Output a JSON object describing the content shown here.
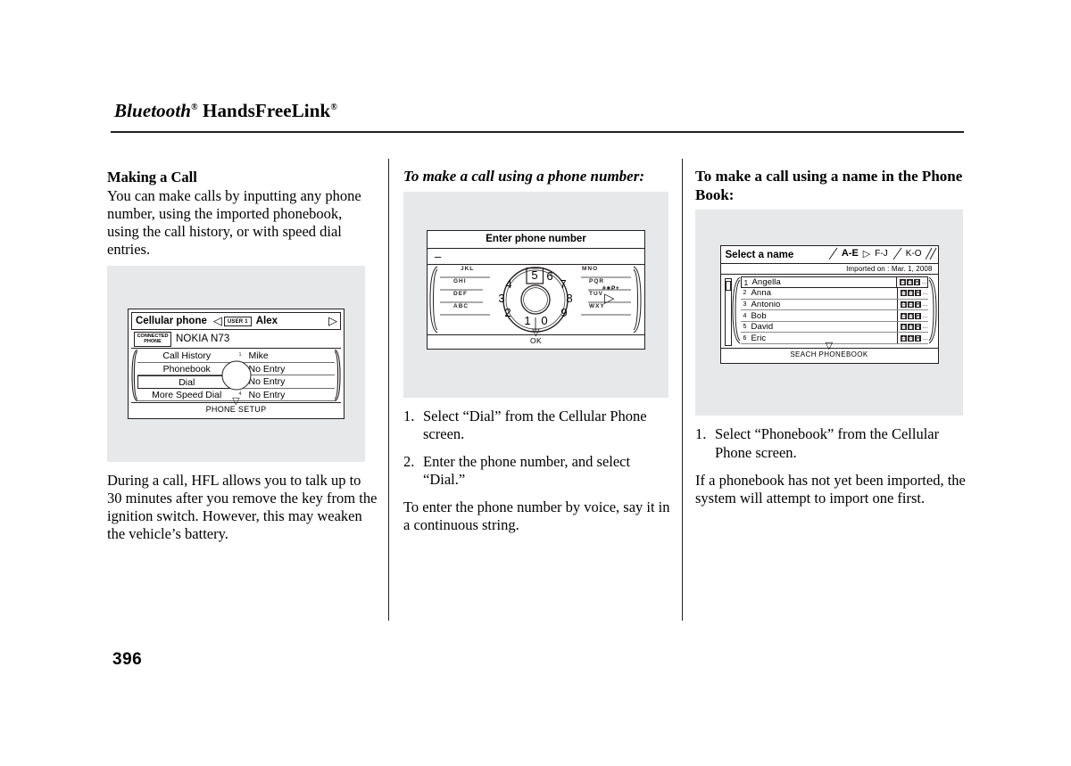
{
  "header": {
    "title_main": "Bluetooth",
    "title_sup1": "®",
    "title_rest": " HandsFreeLink",
    "title_sup2": "®"
  },
  "page_number": "396",
  "col1": {
    "heading": "Making a Call",
    "intro": "You can make calls by inputting any phone number, using the imported phonebook, using the call history, or with speed dial entries.",
    "note": "During a call, HFL allows you to talk up to 30 minutes after you remove the key from the ignition switch. However, this may weaken the vehicle’s battery.",
    "screen": {
      "title": "Cellular phone",
      "user_badge": "USER 1",
      "user_name": "Alex",
      "connected_badge_line1": "CONNECTED",
      "connected_badge_line2": "PHONE",
      "phone_model": "NOKIA N73",
      "menu_left": [
        {
          "label": "Call History",
          "selected": false
        },
        {
          "label": "Phonebook",
          "selected": false
        },
        {
          "label": "Dial",
          "selected": true
        },
        {
          "label": "More Speed Dial",
          "selected": false
        }
      ],
      "menu_right": [
        {
          "index": "1",
          "label": "Mike"
        },
        {
          "index": "2",
          "label": "No Entry"
        },
        {
          "index": "3",
          "label": "No Entry"
        },
        {
          "index": "4",
          "label": "No Entry"
        }
      ],
      "footer": "PHONE SETUP"
    }
  },
  "col2": {
    "heading": "To make a call using a phone number:",
    "screen": {
      "title": "Enter phone number",
      "entry_value": "–",
      "selected_digit": "5",
      "digits": [
        "1",
        "2",
        "3",
        "4",
        "5",
        "6",
        "7",
        "8",
        "9",
        "0"
      ],
      "letters_left": [
        "JKL",
        "GHI",
        "DEF",
        "ABC"
      ],
      "letters_right": [
        "MNO",
        "PQR",
        "TUV",
        "WXY"
      ],
      "symbol_label": "#∗P+",
      "footer": "OK"
    },
    "steps": [
      {
        "num": "1.",
        "text": "Select “Dial” from the Cellular Phone screen."
      },
      {
        "num": "2.",
        "text": "Enter the phone number, and select “Dial.”"
      }
    ],
    "note": "To enter the phone number by voice, say it in a continuous string."
  },
  "col3": {
    "heading": "To make a call using a name in the Phone Book:",
    "screen": {
      "title": "Select a name",
      "tabs": [
        {
          "label": "A-E",
          "active": true
        },
        {
          "label": "F-J",
          "active": false
        },
        {
          "label": "K-O",
          "active": false
        }
      ],
      "imported_on": "Imported on : Mar. 1, 2008",
      "entries": [
        {
          "index": "1",
          "name": "Angella",
          "selected": true
        },
        {
          "index": "2",
          "name": "Anna",
          "selected": false
        },
        {
          "index": "3",
          "name": "Antonio",
          "selected": false
        },
        {
          "index": "4",
          "name": "Bob",
          "selected": false
        },
        {
          "index": "5",
          "name": "David",
          "selected": false
        },
        {
          "index": "6",
          "name": "Eric",
          "selected": false
        }
      ],
      "row_icons": [
        "home-icon",
        "office-icon",
        "mobile-icon"
      ],
      "row_ellipsis": "...",
      "footer": "SEACH PHONEBOOK"
    },
    "steps": [
      {
        "num": "1.",
        "text": "Select “Phonebook” from the Cellular Phone screen."
      }
    ],
    "note": "If a phonebook has not yet been imported, the system will attempt to import one first."
  },
  "colors": {
    "ink": "#231f20",
    "figure_bg": "#e6e8e9",
    "rule": "#6d6e70"
  }
}
